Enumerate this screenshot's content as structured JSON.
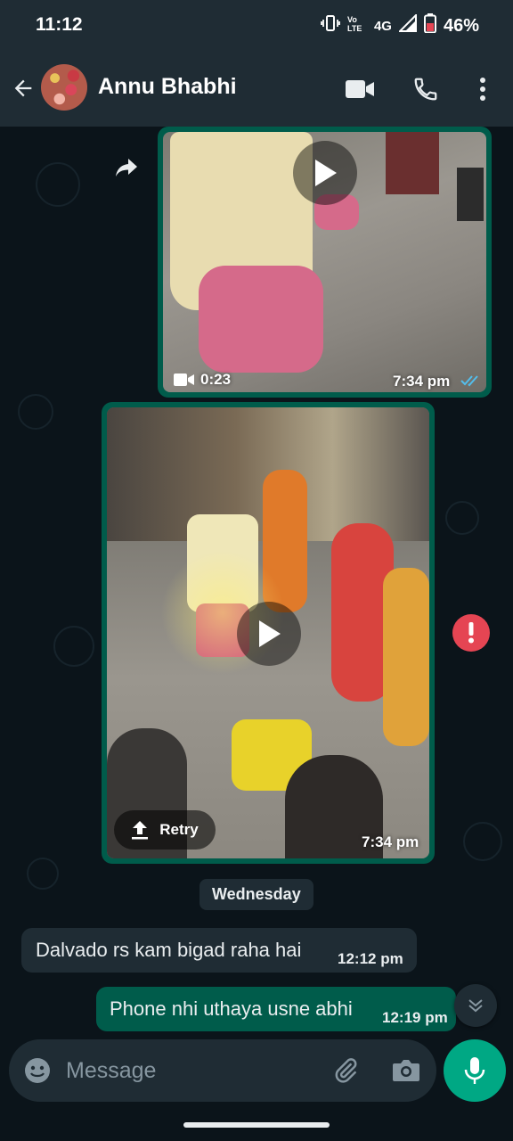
{
  "status_bar": {
    "time": "11:12",
    "network": "4G",
    "battery": "46%",
    "icons": [
      "vibrate-icon",
      "volte-icon",
      "signal-icon",
      "battery-icon"
    ]
  },
  "header": {
    "contact_name": "Annu Bhabhi",
    "icons": [
      "back-arrow-icon",
      "video-call-icon",
      "phone-icon",
      "more-vert-icon"
    ]
  },
  "messages": [
    {
      "type": "video",
      "direction": "outgoing",
      "duration": "0:23",
      "time": "7:34 pm",
      "status": "read"
    },
    {
      "type": "video",
      "direction": "outgoing",
      "upload_label": "Retry",
      "time": "7:34 pm",
      "status": "failed"
    },
    {
      "type": "date",
      "label": "Wednesday"
    },
    {
      "type": "text",
      "direction": "incoming",
      "text": "Dalvado rs kam bigad raha hai",
      "time": "12:12 pm"
    },
    {
      "type": "text",
      "direction": "outgoing",
      "text": "Phone nhi uthaya usne abhi",
      "time": "12:19 pm"
    }
  ],
  "input": {
    "placeholder": "Message",
    "icons": [
      "emoji-icon",
      "attach-icon",
      "camera-icon",
      "mic-icon"
    ]
  },
  "colors": {
    "background": "#0b141a",
    "bar": "#1f2c34",
    "outgoing_bubble": "#005c4b",
    "incoming_bubble": "#1f2c34",
    "accent": "#00a884",
    "error": "#e54553",
    "read_tick": "#53bdeb"
  }
}
